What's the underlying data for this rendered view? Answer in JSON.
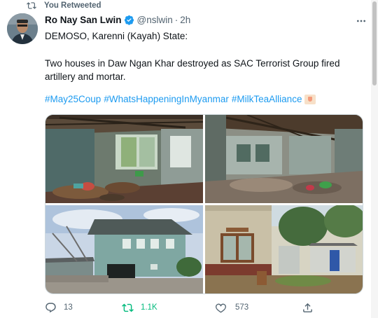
{
  "retweet_indicator": {
    "label": "You Retweeted"
  },
  "author": {
    "name": "Ro Nay San Lwin",
    "handle": "@nslwin",
    "separator": "·",
    "time": "2h",
    "verified": true
  },
  "tweet": {
    "line1": "DEMOSO, Karenni (Kayah) State:",
    "line2": "Two houses in Daw Ngan Khar destroyed as SAC Terrorist Group fired artillery and mortar.",
    "hashtags": [
      "#May25Coup",
      "#WhatsHappeningInMyanmar",
      "#MilkTeaAlliance"
    ],
    "emoji": "milk-tea-emoji"
  },
  "media": {
    "count": 4
  },
  "actions": {
    "reply_count": "13",
    "retweet_count": "1.1K",
    "like_count": "573"
  },
  "colors": {
    "link": "#1d9bf0",
    "retweeted": "#00ba7c",
    "verified": "#1d9bf0",
    "muted": "#536471"
  }
}
